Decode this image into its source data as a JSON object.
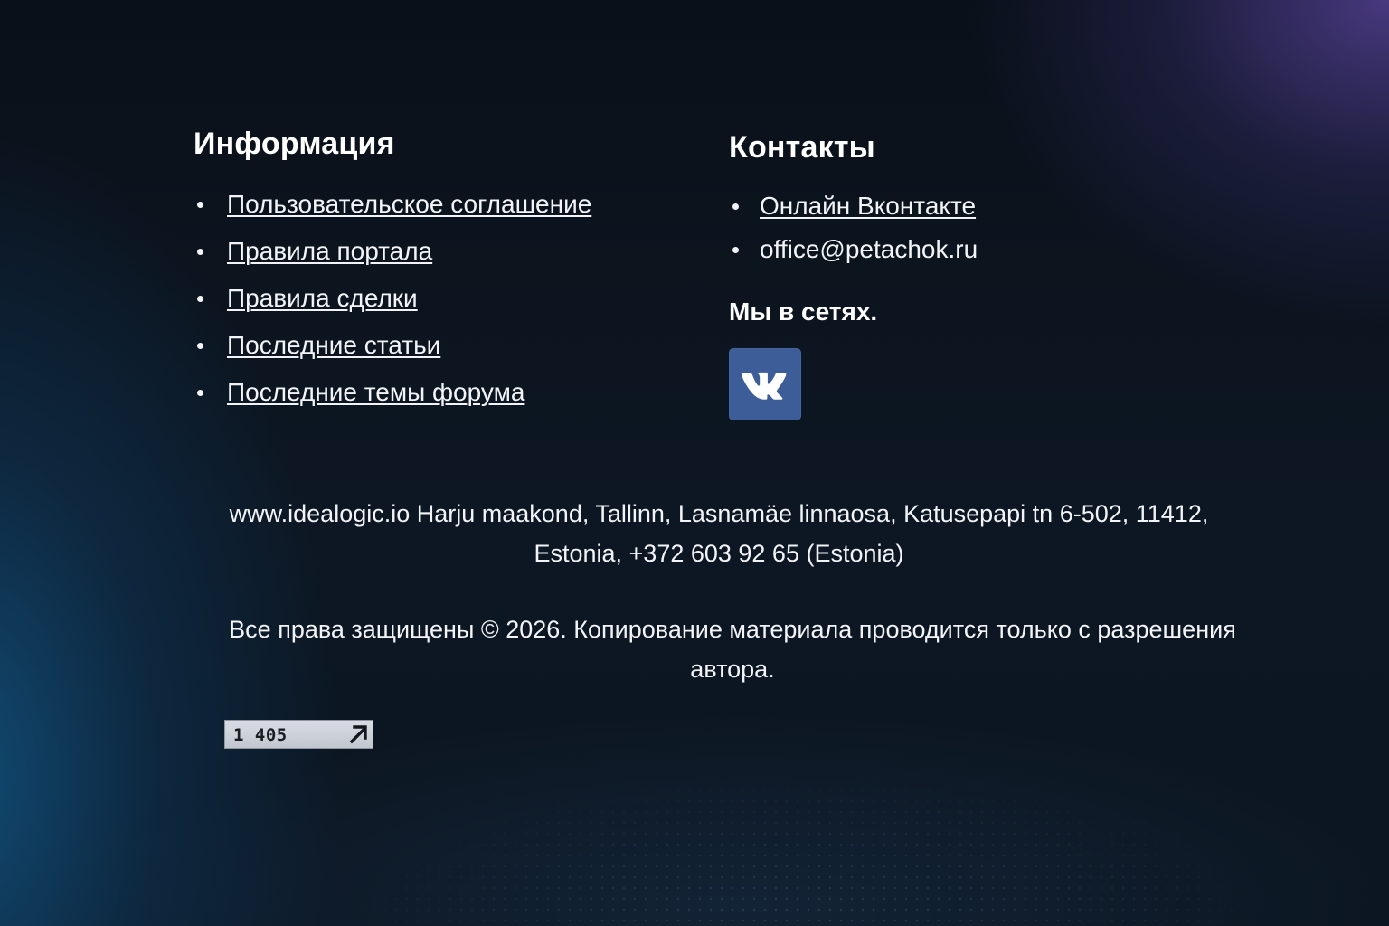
{
  "info": {
    "heading": "Информация",
    "links": [
      {
        "label": "Пользовательское соглашение"
      },
      {
        "label": "Правила портала"
      },
      {
        "label": "Правила сделки"
      },
      {
        "label": "Последние статьи"
      },
      {
        "label": "Последние темы форума"
      }
    ]
  },
  "contacts": {
    "heading": "Контакты",
    "items": [
      {
        "label": "Онлайн Вконтакте",
        "link": true
      },
      {
        "label": "office@petachok.ru",
        "link": false
      }
    ],
    "social_heading": "Мы в сетях.",
    "social": [
      {
        "name": "vk",
        "icon": "vk-logo-icon",
        "color": "#3c5d98"
      }
    ]
  },
  "footer": {
    "address_line1": "www.idealogic.io Harju maakond, Tallinn, Lasnamäe linnaosa, Katusepapi tn 6-502, 11412,",
    "address_line2": "Estonia, +372 603 92 65 (Estonia)",
    "copyright_line1": "Все права защищены © 2026. Копирование материала проводится только с разрешения",
    "copyright_line2": "автора."
  },
  "counter": {
    "value": "1 405",
    "icon": "arrow-up-right-icon"
  },
  "colors": {
    "accent_vk": "#3c5d98",
    "text": "#f2f4f8",
    "background": "#0c1420"
  }
}
